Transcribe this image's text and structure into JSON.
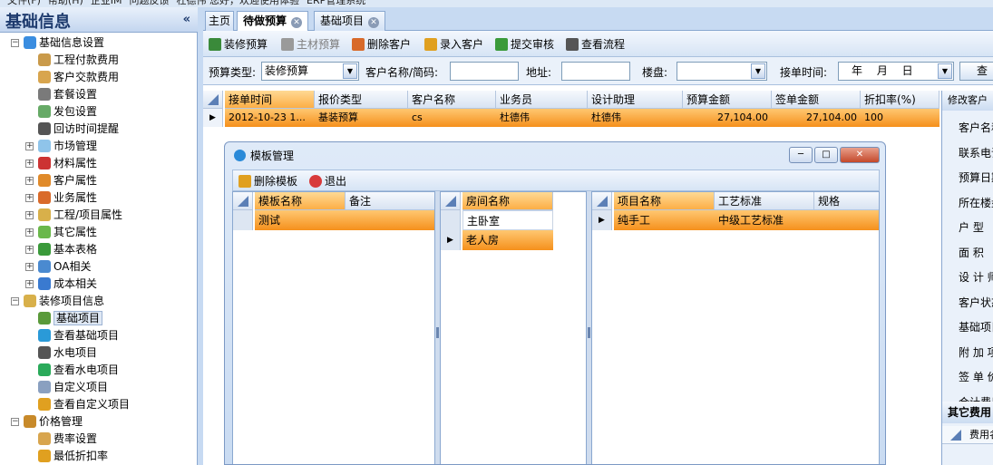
{
  "menubar": {
    "items": [
      "文件(F)",
      "帮助(H)",
      "企业IM",
      "问题反馈",
      "杜德伟 您好，欢迎使用体验",
      "ERP管理系统"
    ]
  },
  "left_panel": {
    "title": "基础信息",
    "collapse": "«",
    "tree": [
      {
        "label": "基础信息设置",
        "level": 0,
        "toggle": "−",
        "icon": "globe-icon",
        "color": "#3a8de0"
      },
      {
        "label": "工程付款费用",
        "level": 1,
        "icon": "payment-icon",
        "color": "#c99a4a"
      },
      {
        "label": "客户交款费用",
        "level": 1,
        "icon": "book-icon",
        "color": "#d8a54e"
      },
      {
        "label": "套餐设置",
        "level": 1,
        "icon": "gear-icon",
        "color": "#7a7a7a"
      },
      {
        "label": "发包设置",
        "level": 1,
        "icon": "dots-icon",
        "color": "#66aa66"
      },
      {
        "label": "回访时间提醒",
        "level": 1,
        "icon": "clock-icon",
        "color": "#555555"
      },
      {
        "label": "市场管理",
        "level": 1,
        "toggle": "+",
        "icon": "cloud-icon",
        "color": "#8fc4ea"
      },
      {
        "label": "材料属性",
        "level": 1,
        "toggle": "+",
        "icon": "flag-icon",
        "color": "#cc3333"
      },
      {
        "label": "客户属性",
        "level": 1,
        "toggle": "+",
        "icon": "users-icon",
        "color": "#e08a2a"
      },
      {
        "label": "业务属性",
        "level": 1,
        "toggle": "+",
        "icon": "person-icon",
        "color": "#d96a2a"
      },
      {
        "label": "工程/项目属性",
        "level": 1,
        "toggle": "+",
        "icon": "building-icon",
        "color": "#d8b04a"
      },
      {
        "label": "其它属性",
        "level": 1,
        "toggle": "+",
        "icon": "puzzle-icon",
        "color": "#6ab84a"
      },
      {
        "label": "基本表格",
        "level": 1,
        "toggle": "+",
        "icon": "table-icon",
        "color": "#3a9a3a"
      },
      {
        "label": "OA相关",
        "level": 1,
        "toggle": "+",
        "icon": "oa-icon",
        "color": "#4a8ad0"
      },
      {
        "label": "成本相关",
        "level": 1,
        "toggle": "+",
        "icon": "chart-icon",
        "color": "#3a7ad0"
      },
      {
        "label": "装修项目信息",
        "level": 0,
        "toggle": "−",
        "icon": "building-icon",
        "color": "#d8b04a"
      },
      {
        "label": "基础项目",
        "level": 1,
        "icon": "worker-icon",
        "color": "#5a9a3a",
        "selected": true
      },
      {
        "label": "查看基础项目",
        "level": 1,
        "icon": "view-icon",
        "color": "#2a9ad8"
      },
      {
        "label": "水电项目",
        "level": 1,
        "icon": "tools-icon",
        "color": "#555555"
      },
      {
        "label": "查看水电项目",
        "level": 1,
        "icon": "view-icon",
        "color": "#2aaa5a"
      },
      {
        "label": "自定义项目",
        "level": 1,
        "icon": "edit-icon",
        "color": "#8aa0c0"
      },
      {
        "label": "查看自定义项目",
        "level": 1,
        "icon": "view-icon",
        "color": "#e0a020"
      },
      {
        "label": "价格管理",
        "level": 0,
        "toggle": "−",
        "icon": "moneybag-icon",
        "color": "#c88a2a"
      },
      {
        "label": "费率设置",
        "level": 1,
        "icon": "rate-icon",
        "color": "#d8a54e"
      },
      {
        "label": "最低折扣率",
        "level": 1,
        "icon": "discount-icon",
        "color": "#e0a020"
      }
    ]
  },
  "tabs": [
    {
      "label": "主页",
      "active": false,
      "closable": false
    },
    {
      "label": "待做预算",
      "active": true,
      "closable": true
    },
    {
      "label": "基础项目",
      "active": false,
      "closable": true
    }
  ],
  "toolbar": {
    "items": [
      {
        "label": "装修预算",
        "icon": "budget-icon",
        "disabled": false
      },
      {
        "label": "主材预算",
        "icon": "material-icon",
        "disabled": true
      },
      {
        "label": "删除客户",
        "icon": "delete-customer-icon",
        "disabled": false
      },
      {
        "label": "录入客户",
        "icon": "add-customer-icon",
        "disabled": false
      },
      {
        "label": "提交审核",
        "icon": "submit-icon",
        "disabled": false
      },
      {
        "label": "查看流程",
        "icon": "flow-icon",
        "disabled": false
      }
    ]
  },
  "filter": {
    "budget_type_label": "预算类型:",
    "budget_type_value": "装修预算",
    "customer_label": "客户名称/简码:",
    "customer_value": "",
    "address_label": "地址:",
    "address_value": "",
    "building_label": "楼盘:",
    "building_value": "",
    "date_label": "接单时间:",
    "date_value": "年 月 日",
    "query_label": "查"
  },
  "grid": {
    "columns": [
      "接单时间",
      "报价类型",
      "客户名称",
      "业务员",
      "设计助理",
      "预算金额",
      "签单金额",
      "折扣率(%)"
    ],
    "rows": [
      [
        "2012-10-23 1...",
        "基装预算",
        "cs",
        "杜德伟",
        "杜德伟",
        "27,104.00",
        "27,104.00",
        "100"
      ]
    ]
  },
  "right_panel": {
    "header": "修改客户",
    "fields": [
      "客户名称",
      "联系电话",
      "预算日期",
      "所在楼盘",
      "户 型",
      "面 积",
      "设 计 师",
      "客户状态",
      "基础项目",
      "附 加 项",
      "签 单 价",
      "合计费用"
    ],
    "section": "其它费用",
    "sub_col": "费用名"
  },
  "dialog": {
    "title": "模板管理",
    "buttons": [
      "删除模板",
      "退出"
    ],
    "templates": {
      "columns": [
        "模板名称",
        "备注"
      ],
      "rows": [
        [
          "测试",
          ""
        ]
      ]
    },
    "rooms": {
      "column": "房间名称",
      "rows": [
        "主卧室",
        "老人房"
      ]
    },
    "items": {
      "columns": [
        "项目名称",
        "工艺标准",
        "规格"
      ],
      "rows": [
        [
          "纯手工",
          "中级工艺标准",
          ""
        ]
      ]
    }
  }
}
